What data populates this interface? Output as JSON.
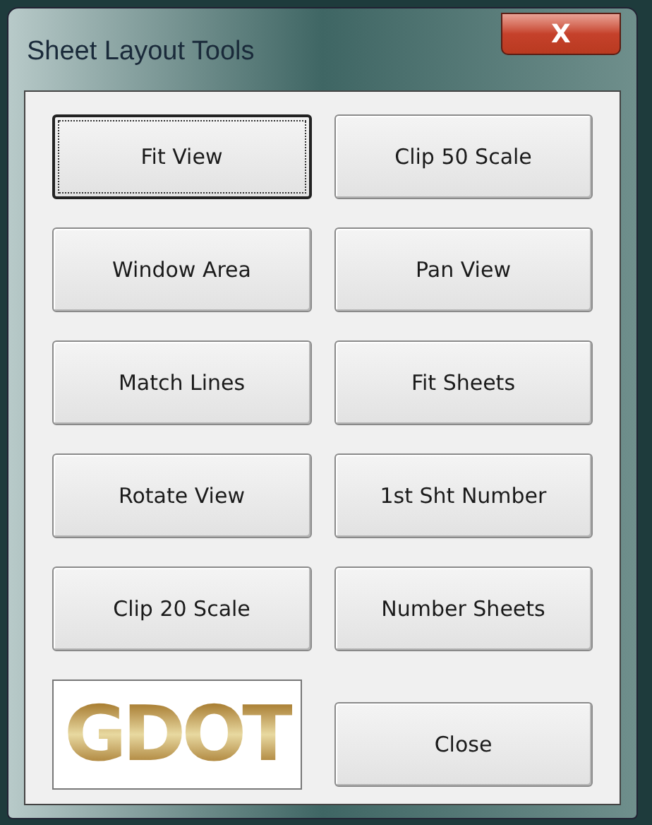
{
  "window": {
    "title": "Sheet Layout Tools",
    "close_glyph": "X"
  },
  "buttons": [
    {
      "label": "Fit View",
      "focused": true
    },
    {
      "label": "Clip 50 Scale",
      "focused": false
    },
    {
      "label": "Window Area",
      "focused": false
    },
    {
      "label": "Pan View",
      "focused": false
    },
    {
      "label": "Match Lines",
      "focused": false
    },
    {
      "label": "Fit Sheets",
      "focused": false
    },
    {
      "label": "Rotate View",
      "focused": false
    },
    {
      "label": "1st Sht Number",
      "focused": false
    },
    {
      "label": "Clip 20 Scale",
      "focused": false
    },
    {
      "label": "Number Sheets",
      "focused": false
    }
  ],
  "logo": {
    "text": "GDOT"
  },
  "close_button": {
    "label": "Close",
    "focused": false
  }
}
